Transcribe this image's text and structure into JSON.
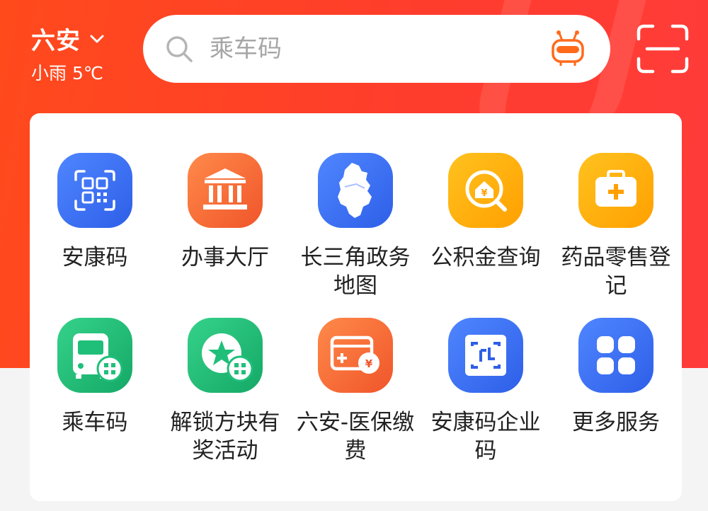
{
  "header": {
    "city": "六安",
    "weather": "小雨 5℃",
    "search_placeholder": "乘车码"
  },
  "icons": {
    "city_dropdown": "chevron-down-icon",
    "search": "search-icon",
    "assistant": "robot-icon",
    "scan": "scan-icon"
  },
  "colors": {
    "header_red": "#ff4a1c",
    "accent_orange": "#ff6a1a",
    "blue": "#3b6df0",
    "green": "#1fbf7a",
    "yellow": "#ffb400"
  },
  "services": [
    {
      "label": "安康码",
      "icon": "qr-code-icon"
    },
    {
      "label": "办事大厅",
      "icon": "government-hall-icon"
    },
    {
      "label": "长三角政务地图",
      "icon": "region-map-icon"
    },
    {
      "label": "公积金查询",
      "icon": "housing-fund-search-icon"
    },
    {
      "label": "药品零售登记",
      "icon": "medical-kit-icon"
    },
    {
      "label": "乘车码",
      "icon": "bus-qr-icon"
    },
    {
      "label": "解锁方块有奖活动",
      "icon": "star-qr-icon"
    },
    {
      "label": "六安-医保缴费",
      "icon": "medical-payment-card-icon"
    },
    {
      "label": "安康码企业码",
      "icon": "enterprise-code-icon"
    },
    {
      "label": "更多服务",
      "icon": "more-services-grid-icon"
    }
  ]
}
